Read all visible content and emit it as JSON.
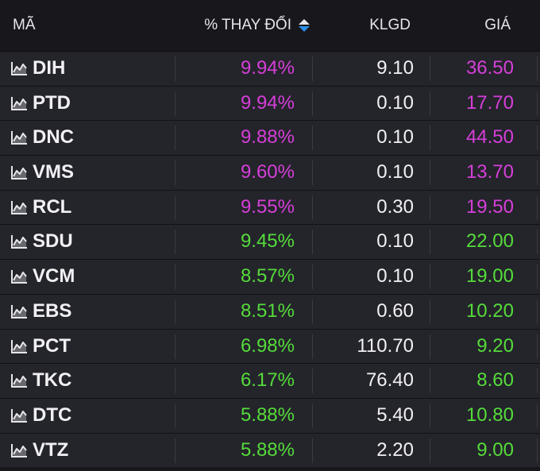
{
  "header": {
    "col_symbol": "MÃ",
    "col_change": "% THAY ĐỔI",
    "col_volume": "KLGD",
    "col_price": "GIÁ"
  },
  "colors": {
    "ceiling": "#d63fd8",
    "up": "#55dc3a",
    "text": "#f1f1f4",
    "sort_active": "#2b8fe8"
  },
  "rows": [
    {
      "symbol": "DIH",
      "change": "9.94%",
      "volume": "9.10",
      "price": "36.50",
      "color": "ceiling"
    },
    {
      "symbol": "PTD",
      "change": "9.94%",
      "volume": "0.10",
      "price": "17.70",
      "color": "ceiling"
    },
    {
      "symbol": "DNC",
      "change": "9.88%",
      "volume": "0.10",
      "price": "44.50",
      "color": "ceiling"
    },
    {
      "symbol": "VMS",
      "change": "9.60%",
      "volume": "0.10",
      "price": "13.70",
      "color": "ceiling"
    },
    {
      "symbol": "RCL",
      "change": "9.55%",
      "volume": "0.30",
      "price": "19.50",
      "color": "ceiling"
    },
    {
      "symbol": "SDU",
      "change": "9.45%",
      "volume": "0.10",
      "price": "22.00",
      "color": "up"
    },
    {
      "symbol": "VCM",
      "change": "8.57%",
      "volume": "0.10",
      "price": "19.00",
      "color": "up"
    },
    {
      "symbol": "EBS",
      "change": "8.51%",
      "volume": "0.60",
      "price": "10.20",
      "color": "up"
    },
    {
      "symbol": "PCT",
      "change": "6.98%",
      "volume": "110.70",
      "price": "9.20",
      "color": "up"
    },
    {
      "symbol": "TKC",
      "change": "6.17%",
      "volume": "76.40",
      "price": "8.60",
      "color": "up"
    },
    {
      "symbol": "DTC",
      "change": "5.88%",
      "volume": "5.40",
      "price": "10.80",
      "color": "up"
    },
    {
      "symbol": "VTZ",
      "change": "5.88%",
      "volume": "2.20",
      "price": "9.00",
      "color": "up"
    }
  ]
}
